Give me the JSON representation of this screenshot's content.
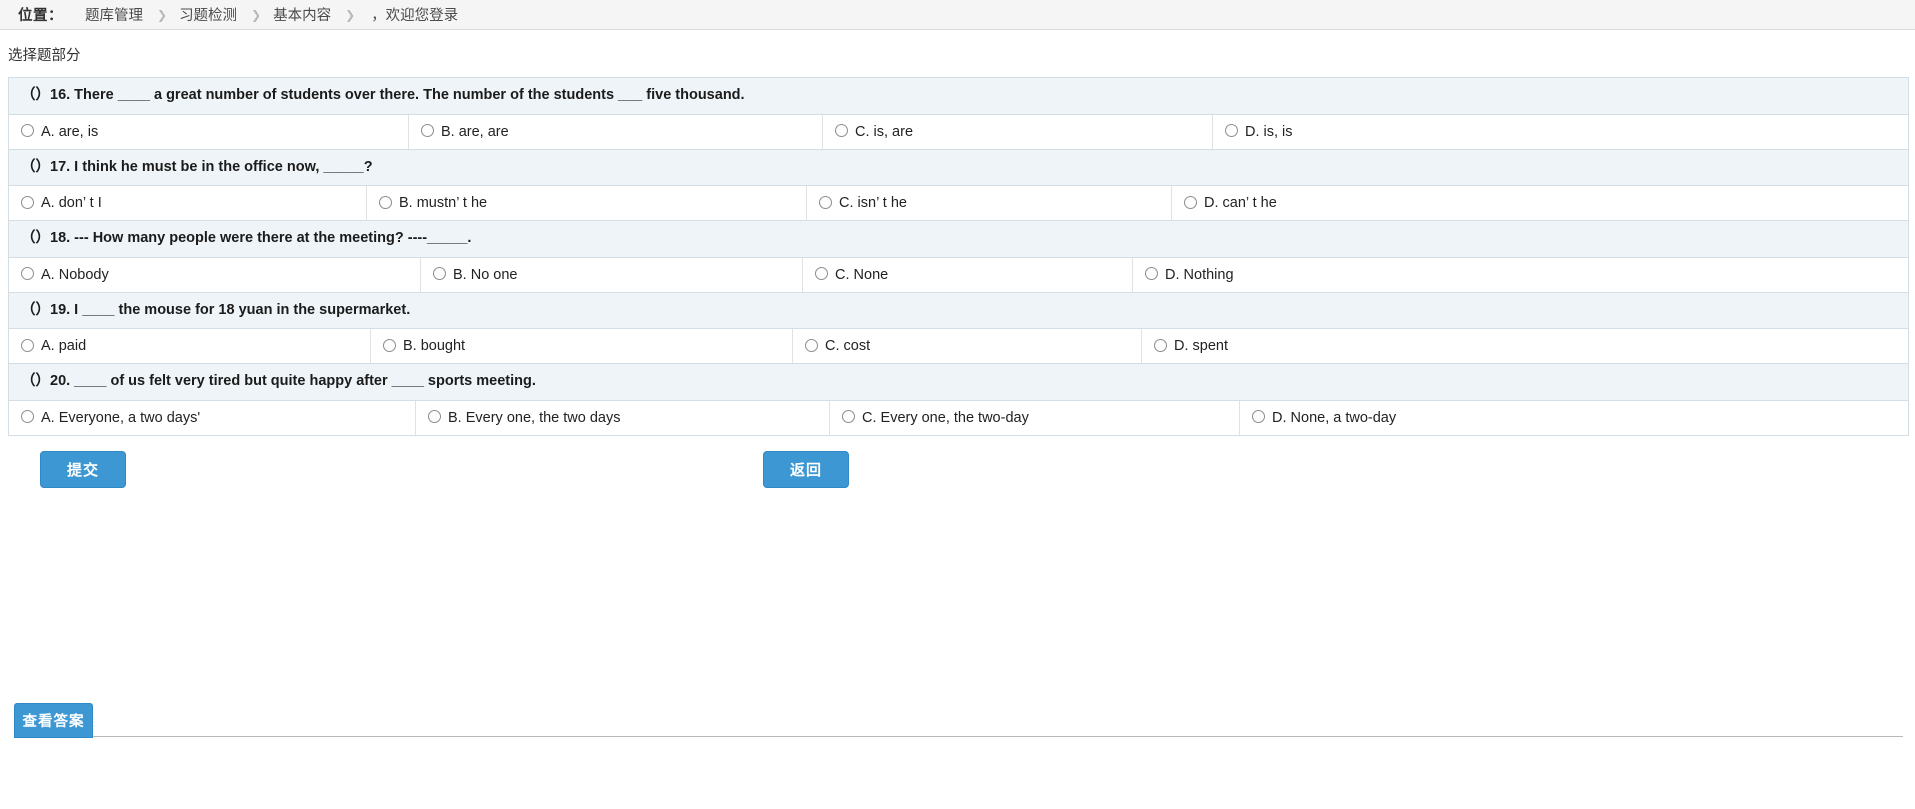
{
  "breadcrumb": {
    "label": "位置：",
    "items": [
      "题库管理",
      "习题检测",
      "基本内容"
    ],
    "separator": "❯",
    "tail": "，欢迎您登录"
  },
  "section": {
    "title": "选择题部分"
  },
  "questions": [
    {
      "number": "16",
      "text": "（）16. There ____ a great number of students over there. The number of the students ___ five thousand.",
      "options": [
        {
          "key": "A",
          "label": "A. are, is"
        },
        {
          "key": "B",
          "label": "B. are, are"
        },
        {
          "key": "C",
          "label": "C. is, are"
        },
        {
          "key": "D",
          "label": "D. is, is"
        }
      ],
      "widths": [
        400,
        414,
        390,
        349
      ]
    },
    {
      "number": "17",
      "text": "（）17. I think he must be in the office now, _____?",
      "options": [
        {
          "key": "A",
          "label": "A. don’ t I"
        },
        {
          "key": "B",
          "label": "B. mustn’ t he"
        },
        {
          "key": "C",
          "label": "C. isn’ t he"
        },
        {
          "key": "D",
          "label": "D. can’ t he"
        }
      ],
      "widths": [
        358,
        440,
        365,
        390
      ]
    },
    {
      "number": "18",
      "text": "（）18. --- How many people were there at the meeting? ----_____.",
      "options": [
        {
          "key": "A",
          "label": "A. Nobody"
        },
        {
          "key": "B",
          "label": "B. No one"
        },
        {
          "key": "C",
          "label": "C. None"
        },
        {
          "key": "D",
          "label": "D. Nothing"
        }
      ],
      "widths": [
        412,
        382,
        330,
        429
      ]
    },
    {
      "number": "19",
      "text": "（）19. I ____ the mouse for 18 yuan in the supermarket.",
      "options": [
        {
          "key": "A",
          "label": "A. paid"
        },
        {
          "key": "B",
          "label": "B. bought"
        },
        {
          "key": "C",
          "label": "C. cost"
        },
        {
          "key": "D",
          "label": "D. spent"
        }
      ],
      "widths": [
        362,
        422,
        349,
        420
      ]
    },
    {
      "number": "20",
      "text": "（）20. ____ of us felt very tired but quite happy after ____ sports meeting.",
      "options": [
        {
          "key": "A",
          "label": "A. Everyone, a two days'"
        },
        {
          "key": "B",
          "label": "B. Every one, the two days"
        },
        {
          "key": "C",
          "label": "C. Every one, the two-day"
        },
        {
          "key": "D",
          "label": "D. None, a two-day"
        }
      ],
      "widths": [
        407,
        414,
        410,
        322
      ]
    }
  ],
  "actions": {
    "submit_label": "提交",
    "back_label": "返回"
  },
  "footer": {
    "view_answer_label": "查看答案"
  },
  "colors": {
    "accent": "#3d97d3",
    "question_row_bg": "#eef4f8",
    "table_border": "#d3dde4",
    "breadcrumb_bg": "#f5f5f5"
  }
}
